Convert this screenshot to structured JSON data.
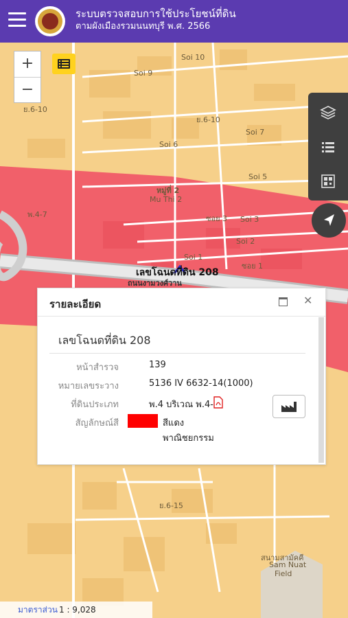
{
  "header": {
    "title": "ระบบตรวจสอบการใช้ประโยชน์ที่ดิน",
    "subtitle": "ตามผังเมืองรวมนนทบุรี พ.ศ. 2566",
    "menu_icon": "hamburger-icon",
    "logo_icon": "government-seal-icon",
    "bar_color": "#5b3bb0"
  },
  "map": {
    "zoom_in": "+",
    "zoom_out": "−",
    "colors": {
      "residential": "#f6d08a",
      "commercial": "#f1606a",
      "road": "#ffffff"
    },
    "labels": {
      "soi10": "Soi 10",
      "soi9": "Soi 9",
      "soi7": "Soi 7",
      "soi6": "Soi 6",
      "soi5": "Soi 5",
      "soi3": "Soi 3",
      "soi2": "Soi 2",
      "soi1": "Soi 1",
      "soi3b": "ซอย 3",
      "soi1b": "ซอย 1",
      "moo2_th": "หมู่ที่ 2",
      "moo2_en": "Mu Thi 2",
      "zone_a": "ย.6-10",
      "zone_b": "ย.6-10",
      "zone_c": "ย.6-15",
      "zone_d": "พ.4-7",
      "road_name": "ถนนงามวงศ์วาน",
      "field_th": "สนามสามัคคี",
      "field_en1": "Sam Nuat",
      "field_en2": "Field"
    },
    "parcel_label": "เลขโฉนดที่ดิน 208"
  },
  "popup": {
    "title": "รายละเอียด",
    "parcel_heading": "เลขโฉนดที่ดิน 208",
    "rows": [
      {
        "label": "หน้าสำรวจ",
        "value": "139"
      },
      {
        "label": "หมายเลขระวาง",
        "value": "5136 IV 6632-14(1000)"
      },
      {
        "label": "ที่ดินประเภท",
        "value": "พ.4 บริเวณ พ.4-7"
      },
      {
        "label": "สัญลักษณ์สี",
        "value": "สีแดง"
      }
    ],
    "category": "พาณิชยกรรม",
    "swatch_color": "#ff0000",
    "close_icon": "close-icon",
    "maximize_icon": "maximize-icon"
  },
  "scale": {
    "label": "มาตราส่วน",
    "value": "1 : 9,028"
  }
}
